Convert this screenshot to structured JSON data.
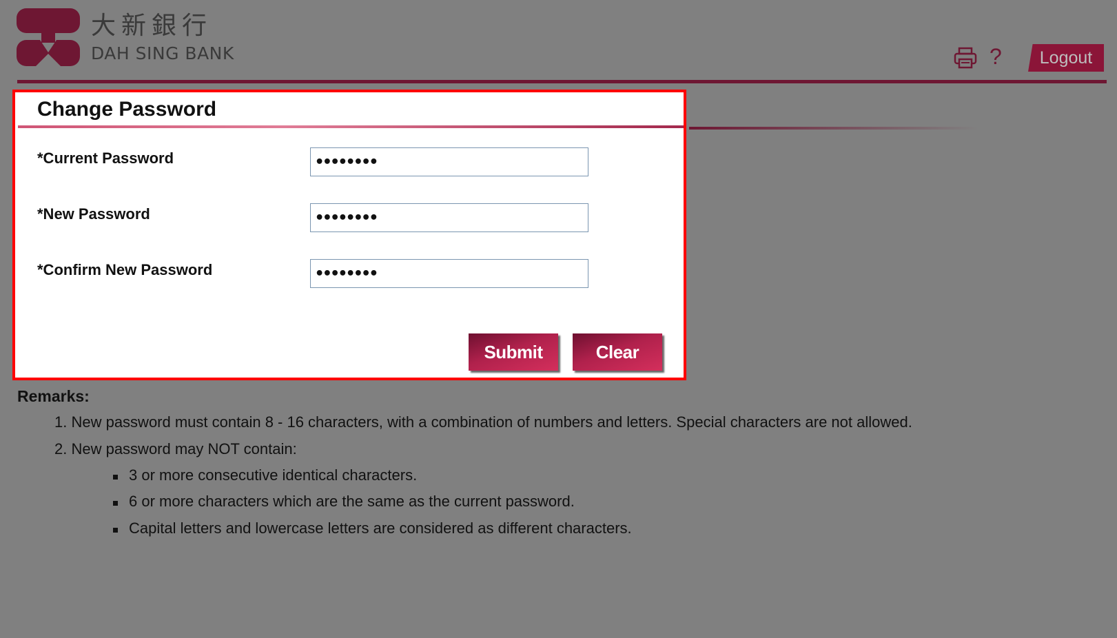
{
  "header": {
    "bank_name_cn": "大新銀行",
    "bank_name_en": "DAH SING BANK",
    "print_icon": "printer-icon",
    "help_label": "?",
    "logout_label": "Logout"
  },
  "form": {
    "title": "Change Password",
    "fields": [
      {
        "label": "*Current Password",
        "value": "••••••••"
      },
      {
        "label": "*New Password",
        "value": "••••••••"
      },
      {
        "label": "*Confirm New Password",
        "value": "••••••••"
      }
    ],
    "submit_label": "Submit",
    "clear_label": "Clear"
  },
  "remarks": {
    "title": "Remarks:",
    "items": [
      "1. New password must contain 8 - 16 characters, with a combination of numbers and letters. Special characters are not allowed.",
      "2. New password may NOT contain:"
    ],
    "subitems": [
      "3 or more consecutive identical characters.",
      "6 or more characters which are the same as the current password.",
      "Capital letters and lowercase letters are considered as different characters."
    ]
  },
  "colors": {
    "brand": "#8b1538",
    "highlight_border": "#ff0000",
    "background": "#808080"
  }
}
